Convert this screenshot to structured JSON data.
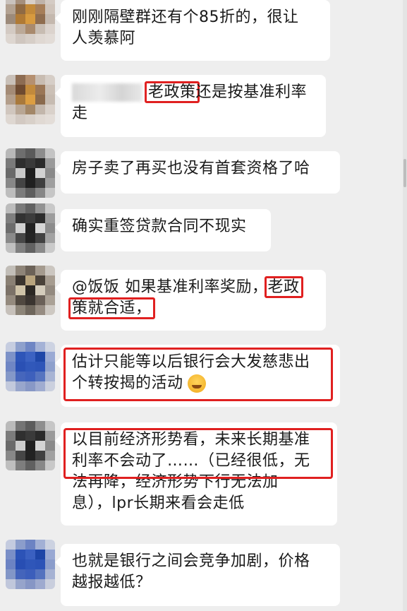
{
  "messages": [
    {
      "lines": [
        "刚刚隔壁群还有个85折的，很让",
        "人羡慕阿"
      ]
    },
    {
      "sender_blurred": true,
      "lines": [
        "老政策还是按基准利率",
        "走"
      ],
      "highlight_word": "老政策"
    },
    {
      "lines": [
        "房子卖了再买也没有首套资格了哈"
      ]
    },
    {
      "lines": [
        "确实重签贷款合同不现实"
      ]
    },
    {
      "lines": [
        "@饭饭 如果基准利率奖励，老政",
        "策就合适，"
      ],
      "highlight_1": "老政",
      "highlight_2": "策就合适，"
    },
    {
      "lines": [
        "估计只能等以后银行会大发慈悲出",
        "个转按揭的活动"
      ],
      "emoji": "grinning-sweat-emoji"
    },
    {
      "lines": [
        "以目前经济形势看，未来长期基准",
        "利率不会动了……（已经很低，无",
        "法再降，经济形势下行无法加",
        "息），lpr长期来看会走低"
      ]
    },
    {
      "lines": [
        "也就是银行之间会竞争加剧，价格",
        "越报越低？"
      ]
    }
  ],
  "highlight_color": "#e02020",
  "bubble_color": "#ffffff",
  "background_color": "#eeeeee"
}
